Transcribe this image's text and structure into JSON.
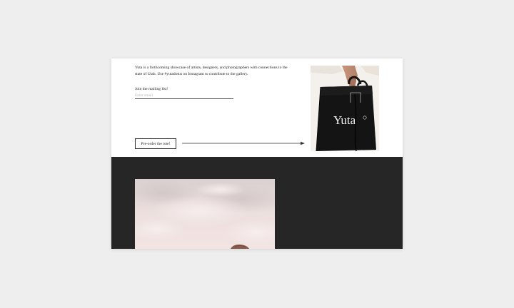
{
  "intro": {
    "text": "Yuta is a forthcoming showcase of artists, designers, and photographers with connections to the state of Utah. Use #yutadotus on Instagram to contribute to the gallery."
  },
  "mailing": {
    "label": "Join the mailing list!",
    "placeholder": "Enter email",
    "value": ""
  },
  "preorder": {
    "label": "Pre-order the tote!"
  },
  "tote": {
    "brand_text": "Yuta"
  },
  "colors": {
    "page_background": "#eeeeee",
    "card_background": "#ffffff",
    "dark_section": "#262626",
    "tote_bag": "#111111"
  },
  "icons": {
    "arrow": "long-right-arrow-icon"
  }
}
